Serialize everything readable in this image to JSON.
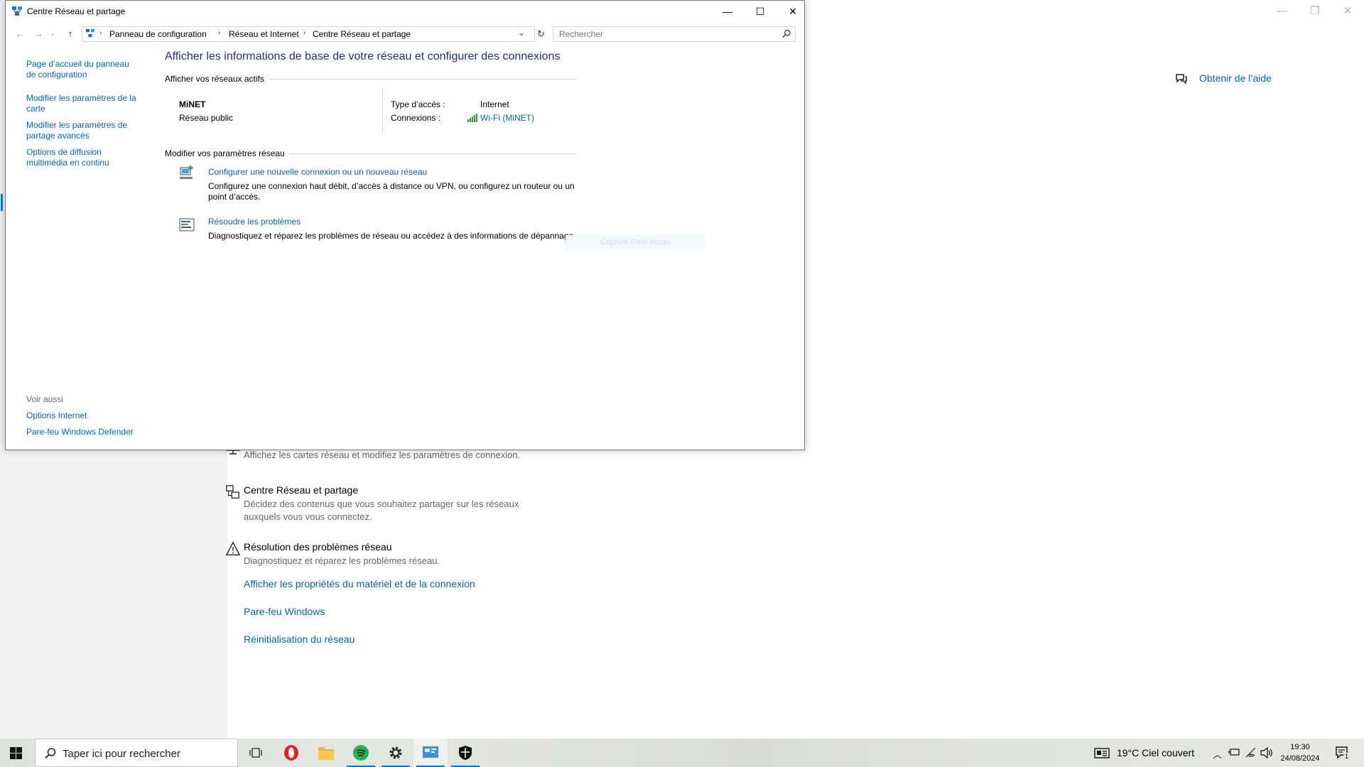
{
  "window": {
    "title": "Centre Réseau et partage",
    "minimize": "—",
    "maximize": "☐",
    "close": "✕"
  },
  "nav": {
    "back": "←",
    "forward": "→",
    "recent": "⌄",
    "up": "↑"
  },
  "address": {
    "crumbs": [
      "Panneau de configuration",
      "Réseau et Internet",
      "Centre Réseau et partage"
    ],
    "separator": "›",
    "dropdown": "⌄",
    "refresh": "↻"
  },
  "search": {
    "placeholder": "Rechercher"
  },
  "sidebar": {
    "links": [
      "Page d’accueil du panneau de configuration",
      "Modifier les paramètres de la carte",
      "Modifier les paramètres de partage avancés",
      "Options de diffusion multimédia en continu"
    ],
    "see_also": "Voir aussi",
    "see_also_links": [
      "Options Internet",
      "Pare-feu Windows Defender"
    ]
  },
  "main": {
    "title": "Afficher les informations de base de votre réseau et configurer des connexions",
    "active_networks_label": "Afficher vos réseaux actifs",
    "network_name": "MiNET",
    "network_type": "Réseau public",
    "access_type_label": "Type d’accès :",
    "access_type_value": "Internet",
    "connections_label": "Connexions :",
    "connection_value": "Wi-Fi (MiNET)",
    "change_settings_label": "Modifier vos paramètres réseau",
    "tasks": [
      {
        "link": "Configurer une nouvelle connexion ou un nouveau réseau",
        "desc_line1": "Configurez une connexion haut débit, d’accès à distance ou VPN, ou configurez un routeur ou un",
        "desc_line2": "point d’accès."
      },
      {
        "link": "Résoudre les problèmes",
        "desc_line1": "Diagnostiquez et réparez les problèmes de réseau ou accédez à des informations de dépannage."
      }
    ],
    "ghost_tooltip": "Capture Plein écran"
  },
  "settings_bg": {
    "help_link": "Obtenir de l’aide",
    "partial_desc": "Affichez les cartes réseau et modifiez les paramètres de connexion.",
    "items": [
      {
        "title": "Centre Réseau et partage",
        "desc_line1": "Décidez des contenus que vous souhaitez partager sur les réseaux",
        "desc_line2": "auxquels vous vous connectez."
      },
      {
        "title": "Résolution des problèmes réseau",
        "desc_line1": "Diagnostiquez et réparez les problèmes réseau."
      }
    ],
    "links": [
      "Afficher les propriétés du matériel et de la connexion",
      "Pare-feu Windows",
      "Réinitialisation du réseau"
    ],
    "win_min": "—",
    "win_restore": "❐",
    "win_close": "✕"
  },
  "taskbar": {
    "search_placeholder": "Taper ici pour rechercher",
    "weather": "19°C  Ciel couvert",
    "time": "19:30",
    "date": "24/08/2024",
    "notification_count": "1"
  },
  "colors": {
    "link": "#0066cc",
    "title_blue": "#1e3287",
    "accent": "#0078d7"
  }
}
